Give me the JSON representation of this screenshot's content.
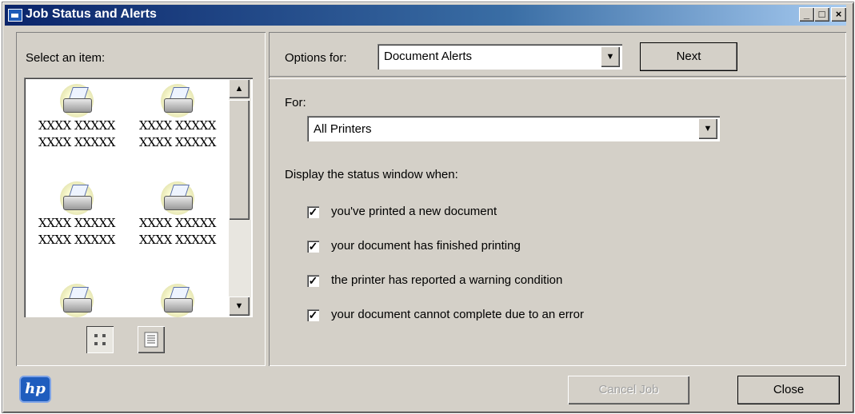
{
  "window": {
    "title": "Job Status and Alerts",
    "controls": {
      "minimize": "_",
      "maximize": "□",
      "close": "×"
    }
  },
  "left": {
    "heading": "Select an item:",
    "items": [
      {
        "line1": "XXXX XXXXX",
        "line2": "XXXX XXXXX",
        "icon": "printer-icon"
      },
      {
        "line1": "XXXX XXXXX",
        "line2": "XXXX XXXXX",
        "icon": "printer-icon"
      },
      {
        "line1": "XXXX XXXXX",
        "line2": "XXXX XXXXX",
        "icon": "printer-icon"
      },
      {
        "line1": "XXXX XXXXX",
        "line2": "XXXX XXXXX",
        "icon": "printer-icon"
      },
      {
        "line1": "",
        "line2": "",
        "icon": "printer-icon"
      },
      {
        "line1": "",
        "line2": "",
        "icon": "printer-icon"
      }
    ],
    "views": [
      "large-icons-view",
      "details-view"
    ]
  },
  "right": {
    "options_label": "Options for:",
    "options_value": "Document Alerts",
    "next_label": "Next",
    "for_label": "For:",
    "for_value": "All Printers",
    "display_label": "Display the status window when:",
    "checks": [
      {
        "label": "you've printed a new document",
        "checked": true
      },
      {
        "label": "your document has finished printing",
        "checked": true
      },
      {
        "label": "the printer has reported a warning condition",
        "checked": true
      },
      {
        "label": "your document cannot complete due to an error",
        "checked": true
      }
    ]
  },
  "footer": {
    "logo": "hp",
    "cancel_label": "Cancel Job",
    "close_label": "Close"
  }
}
